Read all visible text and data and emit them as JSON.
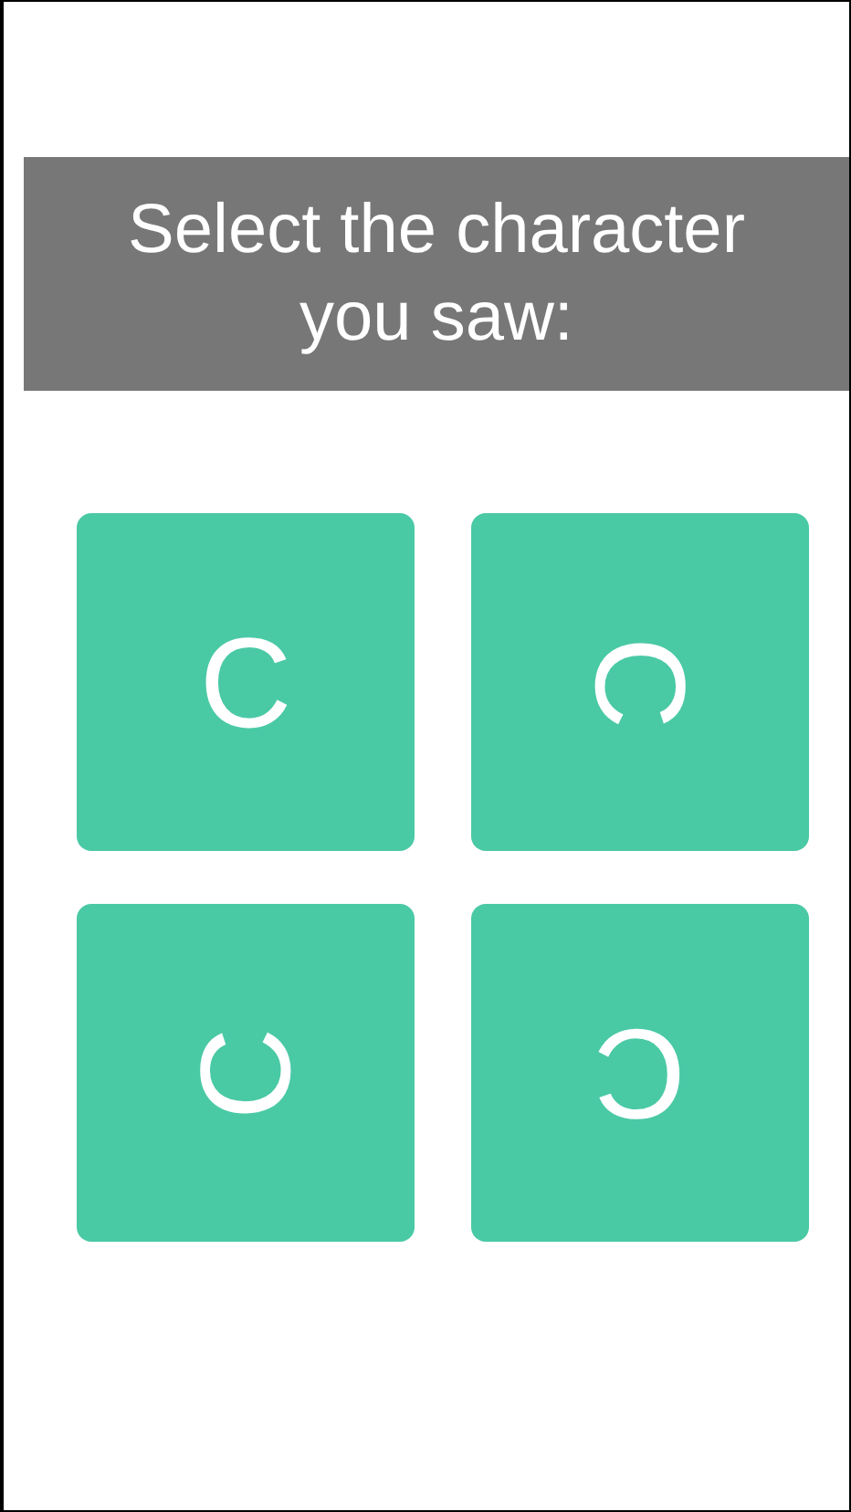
{
  "prompt": "Select the character you saw:",
  "choices": [
    {
      "character": "C",
      "kind": "upright"
    },
    {
      "character": "C",
      "kind": "clockwise"
    },
    {
      "character": "C",
      "kind": "counterclockwise"
    },
    {
      "character": "C",
      "kind": "inverted"
    }
  ]
}
